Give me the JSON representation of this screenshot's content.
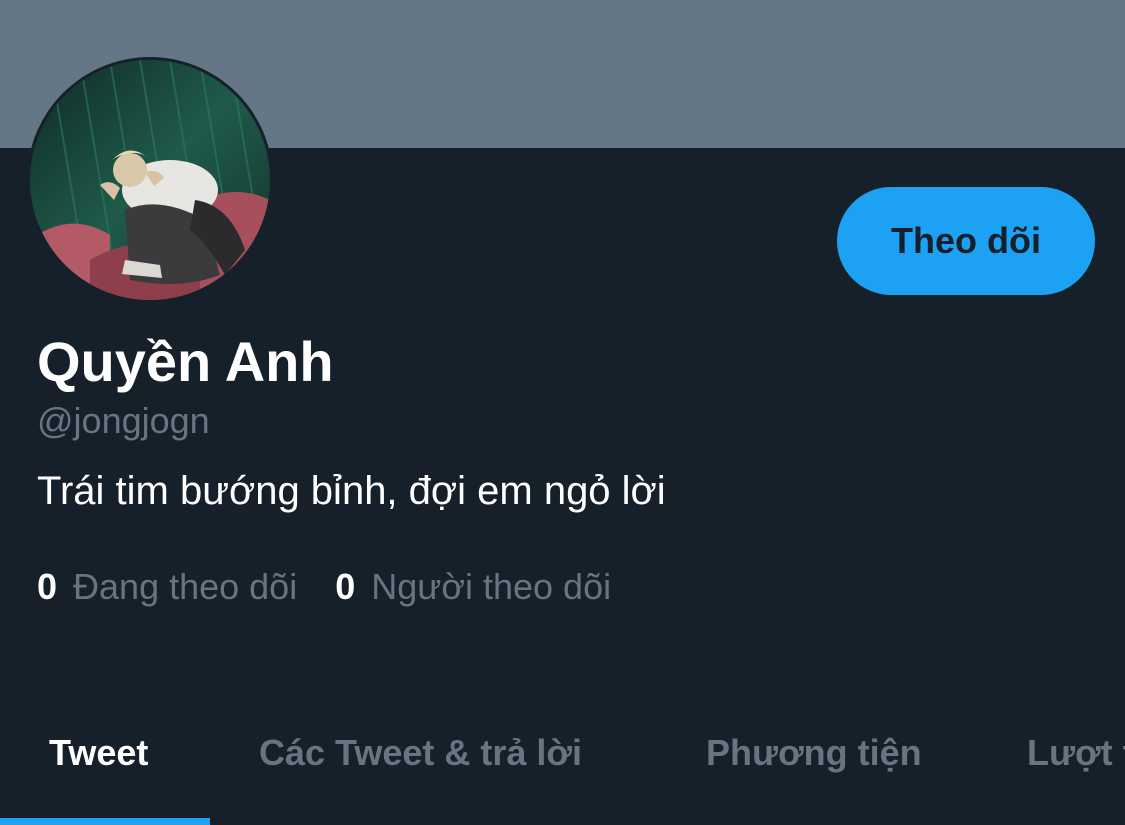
{
  "colors": {
    "background": "#15202b",
    "banner": "#657786",
    "accent": "#1da1f2",
    "muted_text": "#66757f",
    "primary_text": "#ffffff"
  },
  "profile": {
    "display_name": "Quyền Anh",
    "handle": "@jongjogn",
    "bio": "Trái tim bướng bỉnh, đợi em ngỏ lời",
    "avatar_icon": "user-photo-avatar"
  },
  "actions": {
    "follow_label": "Theo dõi"
  },
  "stats": {
    "following_count": "0",
    "following_label": "Đang theo dõi",
    "followers_count": "0",
    "followers_label": "Người theo dõi"
  },
  "tabs": [
    {
      "label": "Tweet",
      "active": true
    },
    {
      "label": "Các Tweet & trả lời",
      "active": false
    },
    {
      "label": "Phương tiện",
      "active": false
    },
    {
      "label": "Lượt thích",
      "active": false
    }
  ]
}
